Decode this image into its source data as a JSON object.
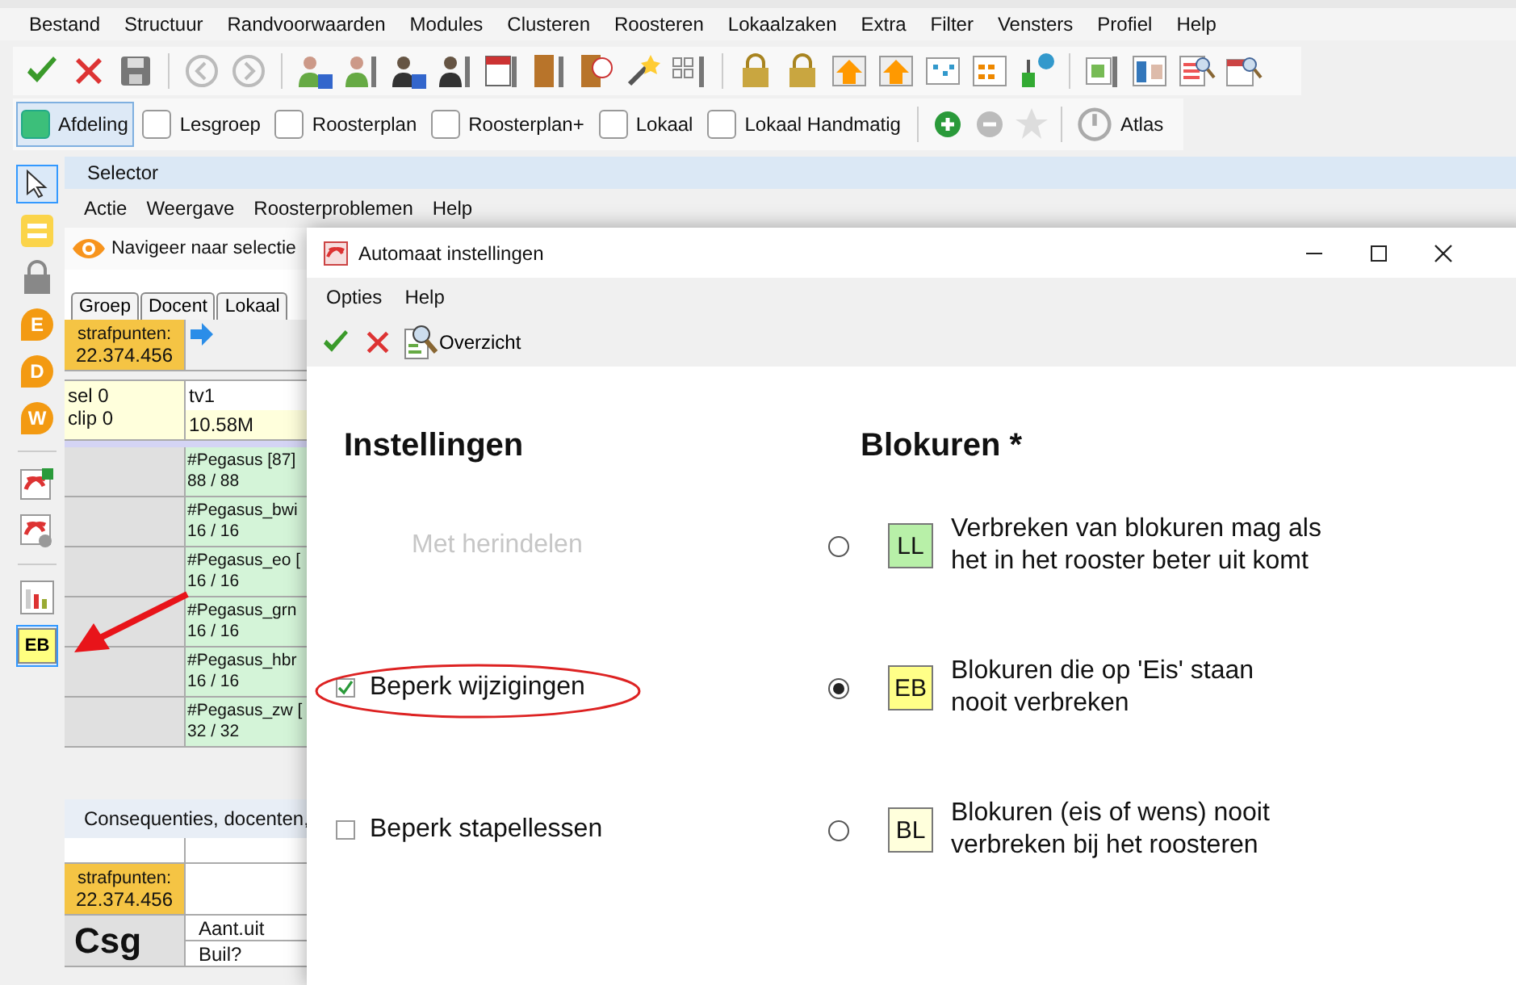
{
  "menu_bar": [
    "Bestand",
    "Structuur",
    "Randvoorwaarden",
    "Modules",
    "Clusteren",
    "Roosteren",
    "Lokaalzaken",
    "Extra",
    "Filter",
    "Vensters",
    "Profiel",
    "Help"
  ],
  "filter_toggles": [
    {
      "label": "Afdeling",
      "checked": true
    },
    {
      "label": "Lesgroep",
      "checked": false
    },
    {
      "label": "Roosterplan",
      "checked": false
    },
    {
      "label": "Roosterplan+",
      "checked": false
    },
    {
      "label": "Lokaal",
      "checked": false
    },
    {
      "label": "Lokaal Handmatig",
      "checked": false
    }
  ],
  "atlas_button": "Atlas",
  "side_tools": [
    {
      "kind": "pointer",
      "selected": true
    },
    {
      "kind": "lines",
      "selected": false
    },
    {
      "kind": "lock",
      "selected": false
    },
    {
      "kind": "badge",
      "label": "E",
      "selected": false
    },
    {
      "kind": "badge",
      "label": "D",
      "selected": false
    },
    {
      "kind": "badge",
      "label": "W",
      "selected": false
    },
    {
      "kind": "separator"
    },
    {
      "kind": "export",
      "selected": false
    },
    {
      "kind": "settings",
      "selected": false
    },
    {
      "kind": "separator"
    },
    {
      "kind": "chart",
      "selected": false
    },
    {
      "kind": "code",
      "label": "EB",
      "selected": true
    }
  ],
  "selector": {
    "title": "Selector",
    "menu": [
      "Actie",
      "Weergave",
      "Roosterproblemen",
      "Help"
    ],
    "navigate": "Navigeer naar selectie",
    "tabs": [
      "Groep",
      "Docent",
      "Lokaal"
    ],
    "penalty_label": "strafpunten:",
    "penalty_value": "22.374.456",
    "sel": "sel 0",
    "clip": "clip 0",
    "tv": "tv1",
    "memory": "10.58M",
    "rows": [
      {
        "name": "#Pegasus [87]",
        "count": "88 / 88"
      },
      {
        "name": "#Pegasus_bwi",
        "count": "16 / 16"
      },
      {
        "name": "#Pegasus_eo [",
        "count": "16 / 16"
      },
      {
        "name": "#Pegasus_grn",
        "count": "16 / 16"
      },
      {
        "name": "#Pegasus_hbr",
        "count": "16 / 16"
      },
      {
        "name": "#Pegasus_zw [",
        "count": "32 / 32"
      }
    ]
  },
  "consequences": {
    "title": "Consequenties, docenten,",
    "penalty_label": "strafpunten:",
    "penalty_value": "22.374.456",
    "name": "Csg",
    "rows": [
      "Aant.uit",
      "Buil?"
    ]
  },
  "dialog": {
    "title": "Automaat instellingen",
    "menu": [
      "Opties",
      "Help"
    ],
    "overview_button": "Overzicht",
    "left_heading": "Instellingen",
    "right_heading": "Blokuren *",
    "options": [
      {
        "kind": "label",
        "label": "Met herindelen",
        "disabled": true
      },
      {
        "kind": "checkbox",
        "label": "Beperk wijzigingen",
        "checked": true,
        "circled": true
      },
      {
        "kind": "checkbox",
        "label": "Beperk stapellessen",
        "checked": false,
        "circled": false
      }
    ],
    "block_modes": [
      {
        "code": "LL",
        "color": "#b8f0a8",
        "lines": [
          "Verbreken van blokuren mag als",
          "het in het rooster beter uit komt"
        ],
        "selected": false
      },
      {
        "code": "EB",
        "color": "#ffff88",
        "lines": [
          "Blokuren die op 'Eis' staan",
          "nooit verbreken"
        ],
        "selected": true
      },
      {
        "code": "BL",
        "color": "#ffffdc",
        "lines": [
          "Blokuren (eis of wens) nooit",
          "verbreken bij het roosteren"
        ],
        "selected": false
      }
    ]
  }
}
